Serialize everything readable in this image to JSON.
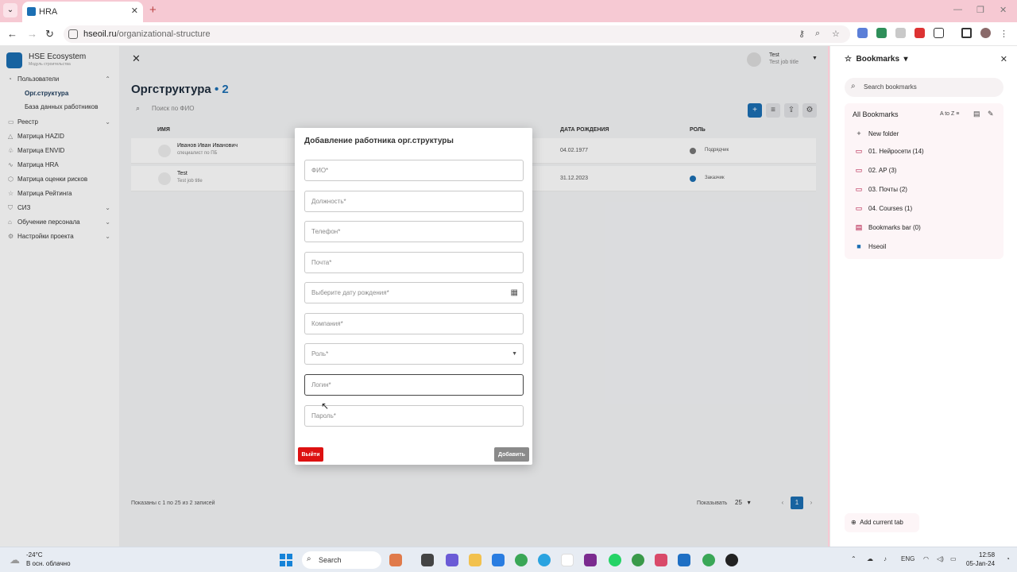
{
  "browser": {
    "tab_title": "HRA",
    "url_domain": "hseoil.ru",
    "url_path": "/organizational-structure"
  },
  "sidebar": {
    "brand": "HSE Ecosystem",
    "brand_sub": "Модуль строительства",
    "items": [
      {
        "label": "Пользователи"
      },
      {
        "label": "Орг.структура"
      },
      {
        "label": "База данных работников"
      },
      {
        "label": "Реестр"
      },
      {
        "label": "Матрица HAZID"
      },
      {
        "label": "Матрица ENVID"
      },
      {
        "label": "Матрица HRA"
      },
      {
        "label": "Матрица оценки рисков"
      },
      {
        "label": "Матрица Рейтинга"
      },
      {
        "label": "СИЗ"
      },
      {
        "label": "Обучение персонала"
      },
      {
        "label": "Настройки проекта"
      }
    ]
  },
  "header": {
    "user_name": "Test",
    "user_job": "Test job title"
  },
  "page": {
    "title": "Оргструктура",
    "count": "• 2",
    "search_placeholder": "Поиск по ФИО"
  },
  "table": {
    "columns": [
      "ИМЯ",
      "ДАТА РОЖДЕНИЯ",
      "РОЛЬ"
    ],
    "rows": [
      {
        "name": "Иванов Иван Иванович",
        "job": "специалист по ПБ",
        "birth": "04.02.1977",
        "role": "Подрядчик",
        "role_color": "#777777"
      },
      {
        "name": "Test",
        "job": "Test job title",
        "birth": "31.12.2023",
        "role": "Заказчик",
        "role_color": "#1b6fb3"
      }
    ],
    "footer": "Показаны с 1 по 25 из 2 записей",
    "page_size_label": "Показывать",
    "page_size": "25",
    "current_page": "1"
  },
  "modal": {
    "title": "Добавление работника орг.структуры",
    "fields": [
      {
        "placeholder": "ФИО*"
      },
      {
        "placeholder": "Должность*"
      },
      {
        "placeholder": "Телефон*"
      },
      {
        "placeholder": "Почта*"
      },
      {
        "placeholder": "Выберите дату рождения*"
      },
      {
        "placeholder": "Компания*"
      },
      {
        "placeholder": "Роль*"
      },
      {
        "placeholder": "Логин*"
      },
      {
        "placeholder": "Пароль*"
      }
    ],
    "exit_label": "Выйти",
    "add_label": "Добавить"
  },
  "bookmarks": {
    "title": "Bookmarks",
    "search_placeholder": "Search bookmarks",
    "all_label": "All Bookmarks",
    "sort_label": "A to Z",
    "new_folder": "New folder",
    "folders": [
      {
        "label": "01. Нейросети (14)"
      },
      {
        "label": "02. AP (3)"
      },
      {
        "label": "03. Почты (2)"
      },
      {
        "label": "04. Courses (1)"
      },
      {
        "label": "Bookmarks bar (0)"
      },
      {
        "label": "Hseoil"
      }
    ],
    "add_current": "Add current tab"
  },
  "taskbar": {
    "temp": "-24°C",
    "weather": "В осн. облачно",
    "search_label": "Search",
    "lang": "ENG",
    "time": "12:58",
    "date": "05-Jan-24"
  }
}
